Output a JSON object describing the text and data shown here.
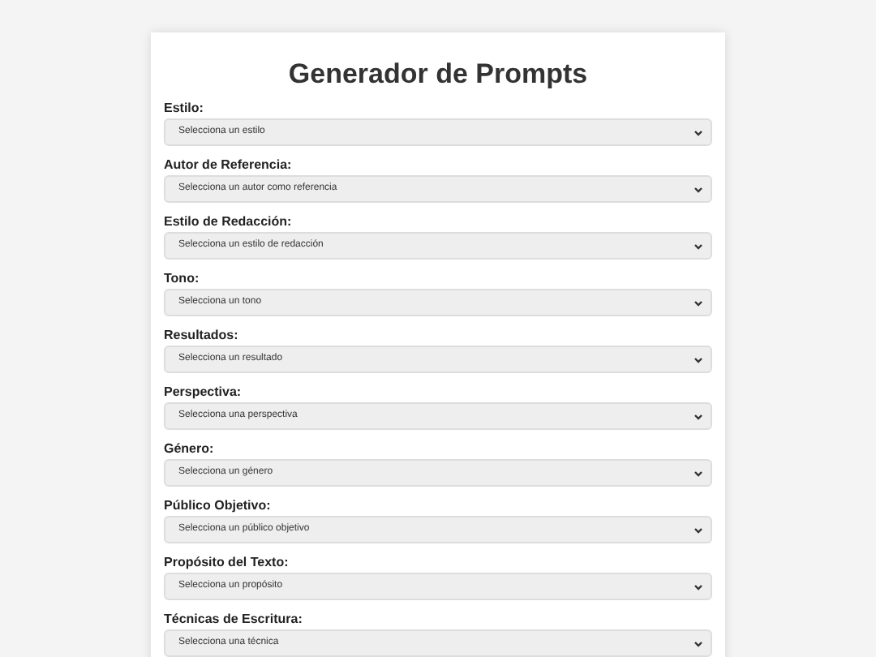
{
  "title": "Generador de Prompts",
  "fields": [
    {
      "label": "Estilo:",
      "placeholder": "Selecciona un estilo"
    },
    {
      "label": "Autor de Referencia:",
      "placeholder": "Selecciona un autor como referencia"
    },
    {
      "label": "Estilo de Redacción:",
      "placeholder": "Selecciona un estilo de redacción"
    },
    {
      "label": "Tono:",
      "placeholder": "Selecciona un tono"
    },
    {
      "label": "Resultados:",
      "placeholder": "Selecciona un resultado"
    },
    {
      "label": "Perspectiva:",
      "placeholder": "Selecciona una perspectiva"
    },
    {
      "label": "Género:",
      "placeholder": "Selecciona un género"
    },
    {
      "label": "Público Objetivo:",
      "placeholder": "Selecciona un público objetivo"
    },
    {
      "label": "Propósito del Texto:",
      "placeholder": "Selecciona un propósito"
    },
    {
      "label": "Técnicas de Escritura:",
      "placeholder": "Selecciona una técnica"
    }
  ]
}
